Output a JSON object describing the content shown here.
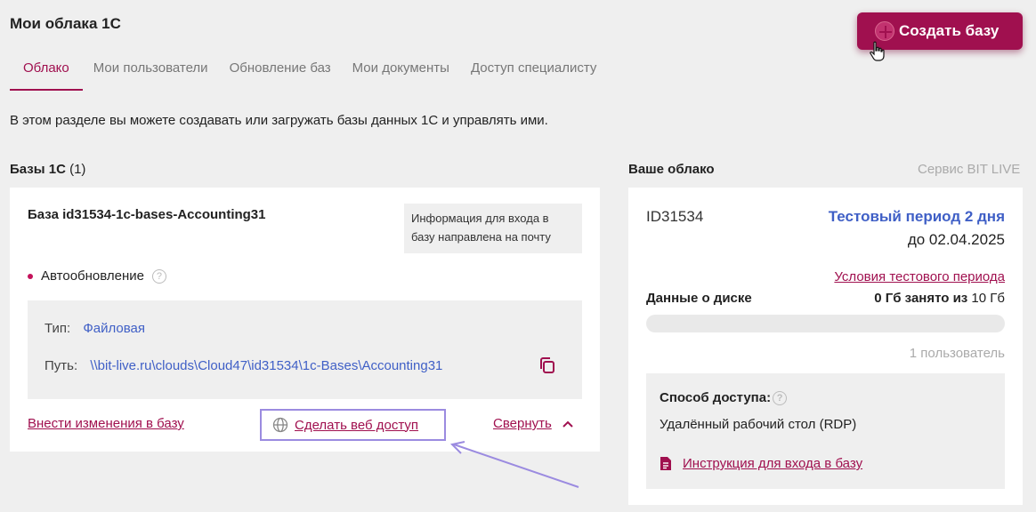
{
  "page": {
    "title": "Мои облака 1С"
  },
  "create_button": {
    "label": "Создать базу"
  },
  "tabs": [
    {
      "label": "Облако",
      "active": true
    },
    {
      "label": "Мои пользователи"
    },
    {
      "label": "Обновление баз"
    },
    {
      "label": "Мои документы"
    },
    {
      "label": "Доступ специалисту"
    }
  ],
  "intro": "В этом разделе вы можете создавать или загружать базы данных 1С и управлять ими.",
  "bases": {
    "title": "Базы 1С",
    "count": "(1)",
    "card": {
      "name": "База id31534-1c-bases-Accounting31",
      "info_note": "Информация для входа в базу направлена на почту",
      "autoupdate": "Автообновление",
      "type_label": "Тип:",
      "type_value": "Файловая",
      "path_label": "Путь:",
      "path_value": "\\\\bit-live.ru\\clouds\\Cloud47\\id31534\\1c-Bases\\Accounting31",
      "edit_link": "Внести изменения в базу",
      "web_access": "Сделать веб доступ",
      "collapse": "Свернуть"
    }
  },
  "cloud": {
    "title": "Ваше облако",
    "service": "Сервис BIT LIVE",
    "id": "ID31534",
    "trial": "Тестовый период 2 дня",
    "until": "до 02.04.2025",
    "terms_link": "Условия тестового периода",
    "disk_label": "Данные о диске",
    "disk_used": "0 Гб занято из",
    "disk_total": "10 Гб",
    "disk_fraction": 0,
    "users": "1 пользователь",
    "access_title": "Способ доступа:",
    "access_value": "Удалённый рабочий стол (RDP)",
    "instruction_link": "Инструкция для входа в базу"
  },
  "colors": {
    "brand": "#a0104f",
    "link_blue": "#3f5fc6",
    "highlight": "#9b8be0"
  },
  "icons": [
    "plus-circle-icon",
    "hand-cursor-icon",
    "help-icon",
    "copy-icon",
    "globe-icon",
    "chevron-up-icon",
    "document-icon"
  ]
}
